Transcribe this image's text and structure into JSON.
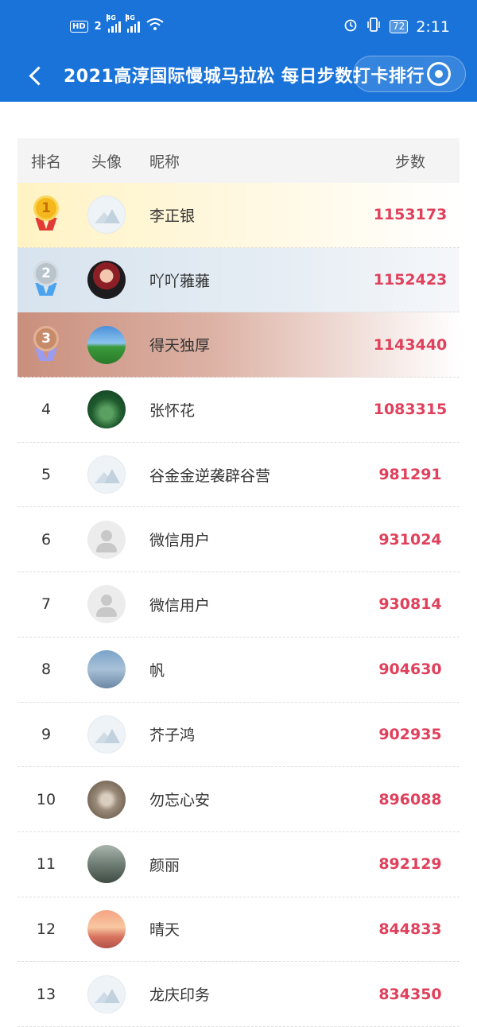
{
  "status_bar": {
    "hd_label": "HD",
    "sim_label": "2",
    "signal_1_tech": "4G",
    "signal_2_tech": "4G",
    "battery": "72",
    "time": "2:11"
  },
  "nav": {
    "title": "2021高淳国际慢城马拉松 每日步数打卡排行"
  },
  "table": {
    "headers": {
      "rank": "排名",
      "avatar": "头像",
      "name": "昵称",
      "steps": "步数"
    },
    "rows": [
      {
        "rank": "1",
        "name": "李正银",
        "steps": "1153173"
      },
      {
        "rank": "2",
        "name": "吖吖蕥蕥",
        "steps": "1152423"
      },
      {
        "rank": "3",
        "name": "得天独厚",
        "steps": "1143440"
      },
      {
        "rank": "4",
        "name": "张怀花",
        "steps": "1083315"
      },
      {
        "rank": "5",
        "name": "谷金金逆袭辟谷营",
        "steps": "981291"
      },
      {
        "rank": "6",
        "name": "微信用户",
        "steps": "931024"
      },
      {
        "rank": "7",
        "name": "微信用户",
        "steps": "930814"
      },
      {
        "rank": "8",
        "name": "帆",
        "steps": "904630"
      },
      {
        "rank": "9",
        "name": "芥子鸿",
        "steps": "902935"
      },
      {
        "rank": "10",
        "name": "勿忘心安",
        "steps": "896088"
      },
      {
        "rank": "11",
        "name": "颜丽",
        "steps": "892129"
      },
      {
        "rank": "12",
        "name": "晴天",
        "steps": "844833"
      },
      {
        "rank": "13",
        "name": "龙庆印务",
        "steps": "834350"
      }
    ]
  },
  "colors": {
    "header_bg": "#1a73d9",
    "steps_text": "#e0405b"
  }
}
